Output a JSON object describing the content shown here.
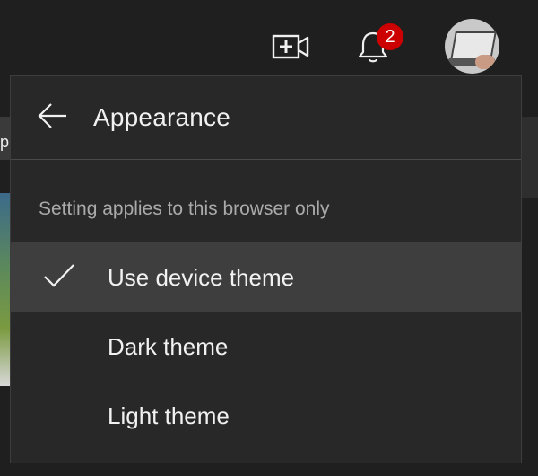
{
  "topbar": {
    "create_icon": "video-plus-icon",
    "notifications_icon": "bell-icon",
    "notification_count": "2",
    "avatar_icon": "user-avatar"
  },
  "background": {
    "chip_text": "p"
  },
  "menu": {
    "title": "Appearance",
    "back_icon": "arrow-left-icon",
    "hint": "Setting applies to this browser only",
    "options": [
      {
        "label": "Use device theme",
        "selected": true
      },
      {
        "label": "Dark theme",
        "selected": false
      },
      {
        "label": "Light theme",
        "selected": false
      }
    ],
    "check_icon": "checkmark-icon"
  },
  "colors": {
    "panel_bg": "#282828",
    "selected_bg": "#3e3e3e",
    "badge_red": "#cc0000",
    "text_primary": "#f1f1f1",
    "text_secondary": "#aaaaaa"
  }
}
